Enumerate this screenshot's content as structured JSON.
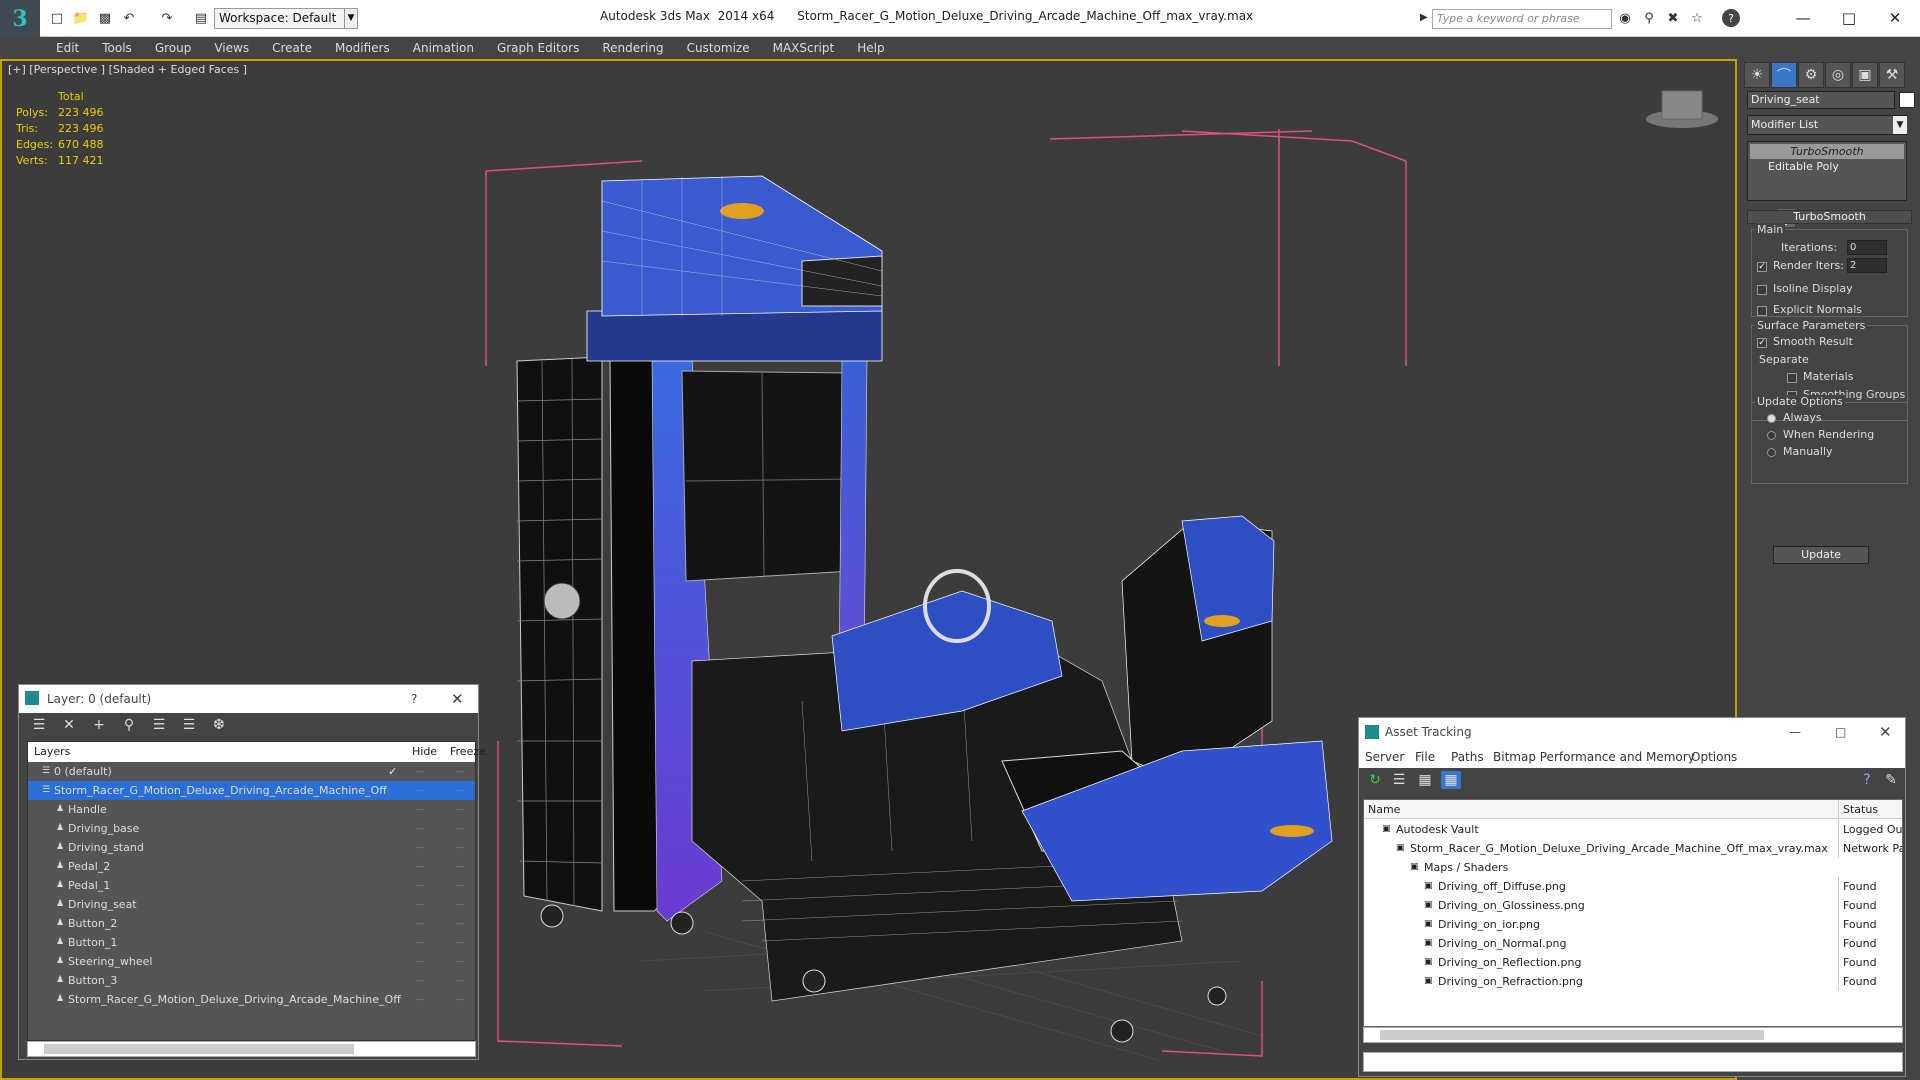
{
  "titlebar": {
    "workspace": "Workspace: Default",
    "title": "Autodesk 3ds Max  2014 x64      Storm_Racer_G_Motion_Deluxe_Driving_Arcade_Machine_Off_max_vray.max",
    "search_placeholder": "Type a keyword or phrase"
  },
  "menu": [
    "Edit",
    "Tools",
    "Group",
    "Views",
    "Create",
    "Modifiers",
    "Animation",
    "Graph Editors",
    "Rendering",
    "Customize",
    "MAXScript",
    "Help"
  ],
  "viewport": {
    "label": "[+] [Perspective ] [Shaded + Edged Faces ]",
    "stats": {
      "header": "Total",
      "rows": [
        {
          "label": "Polys:",
          "value": "223 496"
        },
        {
          "label": "Tris:",
          "value": "223 496"
        },
        {
          "label": "Edges:",
          "value": "670 488"
        },
        {
          "label": "Verts:",
          "value": "117 421"
        }
      ]
    }
  },
  "command_panel": {
    "object_name": "Driving_seat",
    "modifier_list": "Modifier List",
    "stack": [
      "TurboSmooth",
      "Editable Poly"
    ],
    "rollout_title": "TurboSmooth",
    "main_label": "Main",
    "iterations_label": "Iterations:",
    "iterations_value": "0",
    "render_iters_label": "Render Iters:",
    "render_iters_value": "2",
    "isoline_label": "Isoline Display",
    "explicit_normals_label": "Explicit Normals",
    "surface_params_label": "Surface Parameters",
    "smooth_result_label": "Smooth Result",
    "separate_label": "Separate",
    "materials_label": "Materials",
    "smoothing_groups_label": "Smoothing Groups",
    "update_options_label": "Update Options",
    "always_label": "Always",
    "when_rendering_label": "When Rendering",
    "manually_label": "Manually",
    "update_button": "Update"
  },
  "layer_window": {
    "title": "Layer: 0 (default)",
    "help": "?",
    "col_layers": "Layers",
    "col_hide": "Hide",
    "col_freeze": "Freeze",
    "rows": [
      {
        "name": "0 (default)",
        "indent": 0
      },
      {
        "name": "Storm_Racer_G_Motion_Deluxe_Driving_Arcade_Machine_Off",
        "indent": 0
      },
      {
        "name": "Handle",
        "indent": 1
      },
      {
        "name": "Driving_base",
        "indent": 1
      },
      {
        "name": "Driving_stand",
        "indent": 1
      },
      {
        "name": "Pedal_2",
        "indent": 1
      },
      {
        "name": "Pedal_1",
        "indent": 1
      },
      {
        "name": "Driving_seat",
        "indent": 1
      },
      {
        "name": "Button_2",
        "indent": 1
      },
      {
        "name": "Button_1",
        "indent": 1
      },
      {
        "name": "Steering_wheel",
        "indent": 1
      },
      {
        "name": "Button_3",
        "indent": 1
      },
      {
        "name": "Storm_Racer_G_Motion_Deluxe_Driving_Arcade_Machine_Off",
        "indent": 1
      }
    ]
  },
  "asset_window": {
    "title": "Asset Tracking",
    "menu": [
      "Server",
      "File",
      "Paths",
      "Bitmap Performance and Memory",
      "Options"
    ],
    "col_name": "Name",
    "col_status": "Status",
    "rows": [
      {
        "name": "Autodesk Vault",
        "status": "Logged Out",
        "indent": 1
      },
      {
        "name": "Storm_Racer_G_Motion_Deluxe_Driving_Arcade_Machine_Off_max_vray.max",
        "status": "Network Pat",
        "indent": 2
      },
      {
        "name": "Maps / Shaders",
        "status": "",
        "indent": 3
      },
      {
        "name": "Driving_off_Diffuse.png",
        "status": "Found",
        "indent": 4
      },
      {
        "name": "Driving_on_Glossiness.png",
        "status": "Found",
        "indent": 4
      },
      {
        "name": "Driving_on_ior.png",
        "status": "Found",
        "indent": 4
      },
      {
        "name": "Driving_on_Normal.png",
        "status": "Found",
        "indent": 4
      },
      {
        "name": "Driving_on_Reflection.png",
        "status": "Found",
        "indent": 4
      },
      {
        "name": "Driving_on_Refraction.png",
        "status": "Found",
        "indent": 4
      }
    ]
  },
  "colors": {
    "accent_blue": "#3050c8",
    "selection": "#2a6fd6",
    "stats_yellow": "#e8d000",
    "bbox_pink": "#e05080"
  }
}
